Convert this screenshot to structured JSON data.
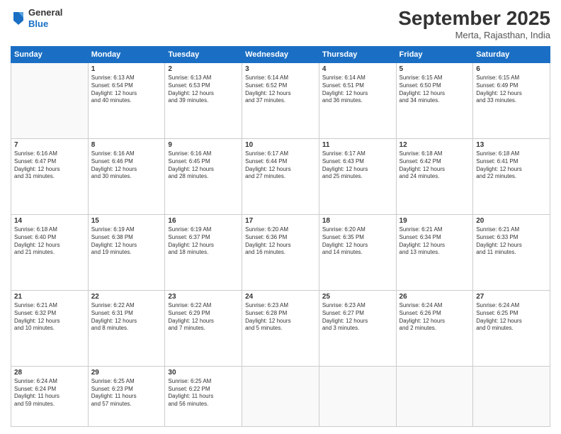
{
  "logo": {
    "general": "General",
    "blue": "Blue"
  },
  "header": {
    "month": "September 2025",
    "location": "Merta, Rajasthan, India"
  },
  "days": [
    "Sunday",
    "Monday",
    "Tuesday",
    "Wednesday",
    "Thursday",
    "Friday",
    "Saturday"
  ],
  "weeks": [
    [
      {
        "day": "",
        "info": ""
      },
      {
        "day": "1",
        "info": "Sunrise: 6:13 AM\nSunset: 6:54 PM\nDaylight: 12 hours\nand 40 minutes."
      },
      {
        "day": "2",
        "info": "Sunrise: 6:13 AM\nSunset: 6:53 PM\nDaylight: 12 hours\nand 39 minutes."
      },
      {
        "day": "3",
        "info": "Sunrise: 6:14 AM\nSunset: 6:52 PM\nDaylight: 12 hours\nand 37 minutes."
      },
      {
        "day": "4",
        "info": "Sunrise: 6:14 AM\nSunset: 6:51 PM\nDaylight: 12 hours\nand 36 minutes."
      },
      {
        "day": "5",
        "info": "Sunrise: 6:15 AM\nSunset: 6:50 PM\nDaylight: 12 hours\nand 34 minutes."
      },
      {
        "day": "6",
        "info": "Sunrise: 6:15 AM\nSunset: 6:49 PM\nDaylight: 12 hours\nand 33 minutes."
      }
    ],
    [
      {
        "day": "7",
        "info": "Sunrise: 6:16 AM\nSunset: 6:47 PM\nDaylight: 12 hours\nand 31 minutes."
      },
      {
        "day": "8",
        "info": "Sunrise: 6:16 AM\nSunset: 6:46 PM\nDaylight: 12 hours\nand 30 minutes."
      },
      {
        "day": "9",
        "info": "Sunrise: 6:16 AM\nSunset: 6:45 PM\nDaylight: 12 hours\nand 28 minutes."
      },
      {
        "day": "10",
        "info": "Sunrise: 6:17 AM\nSunset: 6:44 PM\nDaylight: 12 hours\nand 27 minutes."
      },
      {
        "day": "11",
        "info": "Sunrise: 6:17 AM\nSunset: 6:43 PM\nDaylight: 12 hours\nand 25 minutes."
      },
      {
        "day": "12",
        "info": "Sunrise: 6:18 AM\nSunset: 6:42 PM\nDaylight: 12 hours\nand 24 minutes."
      },
      {
        "day": "13",
        "info": "Sunrise: 6:18 AM\nSunset: 6:41 PM\nDaylight: 12 hours\nand 22 minutes."
      }
    ],
    [
      {
        "day": "14",
        "info": "Sunrise: 6:18 AM\nSunset: 6:40 PM\nDaylight: 12 hours\nand 21 minutes."
      },
      {
        "day": "15",
        "info": "Sunrise: 6:19 AM\nSunset: 6:38 PM\nDaylight: 12 hours\nand 19 minutes."
      },
      {
        "day": "16",
        "info": "Sunrise: 6:19 AM\nSunset: 6:37 PM\nDaylight: 12 hours\nand 18 minutes."
      },
      {
        "day": "17",
        "info": "Sunrise: 6:20 AM\nSunset: 6:36 PM\nDaylight: 12 hours\nand 16 minutes."
      },
      {
        "day": "18",
        "info": "Sunrise: 6:20 AM\nSunset: 6:35 PM\nDaylight: 12 hours\nand 14 minutes."
      },
      {
        "day": "19",
        "info": "Sunrise: 6:21 AM\nSunset: 6:34 PM\nDaylight: 12 hours\nand 13 minutes."
      },
      {
        "day": "20",
        "info": "Sunrise: 6:21 AM\nSunset: 6:33 PM\nDaylight: 12 hours\nand 11 minutes."
      }
    ],
    [
      {
        "day": "21",
        "info": "Sunrise: 6:21 AM\nSunset: 6:32 PM\nDaylight: 12 hours\nand 10 minutes."
      },
      {
        "day": "22",
        "info": "Sunrise: 6:22 AM\nSunset: 6:31 PM\nDaylight: 12 hours\nand 8 minutes."
      },
      {
        "day": "23",
        "info": "Sunrise: 6:22 AM\nSunset: 6:29 PM\nDaylight: 12 hours\nand 7 minutes."
      },
      {
        "day": "24",
        "info": "Sunrise: 6:23 AM\nSunset: 6:28 PM\nDaylight: 12 hours\nand 5 minutes."
      },
      {
        "day": "25",
        "info": "Sunrise: 6:23 AM\nSunset: 6:27 PM\nDaylight: 12 hours\nand 3 minutes."
      },
      {
        "day": "26",
        "info": "Sunrise: 6:24 AM\nSunset: 6:26 PM\nDaylight: 12 hours\nand 2 minutes."
      },
      {
        "day": "27",
        "info": "Sunrise: 6:24 AM\nSunset: 6:25 PM\nDaylight: 12 hours\nand 0 minutes."
      }
    ],
    [
      {
        "day": "28",
        "info": "Sunrise: 6:24 AM\nSunset: 6:24 PM\nDaylight: 11 hours\nand 59 minutes."
      },
      {
        "day": "29",
        "info": "Sunrise: 6:25 AM\nSunset: 6:23 PM\nDaylight: 11 hours\nand 57 minutes."
      },
      {
        "day": "30",
        "info": "Sunrise: 6:25 AM\nSunset: 6:22 PM\nDaylight: 11 hours\nand 56 minutes."
      },
      {
        "day": "",
        "info": ""
      },
      {
        "day": "",
        "info": ""
      },
      {
        "day": "",
        "info": ""
      },
      {
        "day": "",
        "info": ""
      }
    ]
  ]
}
